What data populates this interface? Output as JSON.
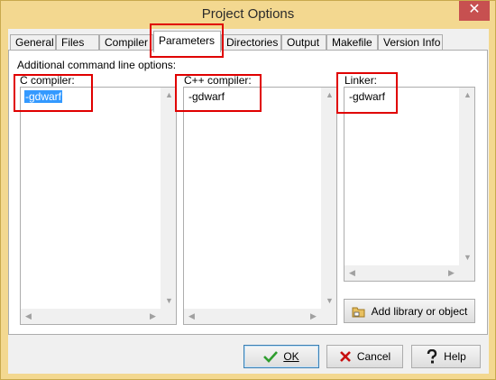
{
  "window": {
    "title": "Project Options",
    "close_glyph": "✕"
  },
  "tabs": [
    {
      "label": "General"
    },
    {
      "label": "Files"
    },
    {
      "label": "Compiler"
    },
    {
      "label": "Parameters"
    },
    {
      "label": "Directories"
    },
    {
      "label": "Output"
    },
    {
      "label": "Makefile"
    },
    {
      "label": "Version Info"
    }
  ],
  "active_tab": "Parameters",
  "page": {
    "heading": "Additional command line options:",
    "c_compiler": {
      "label": "C compiler:",
      "value": "-gdwarf"
    },
    "cpp_compiler": {
      "label": "C++ compiler:",
      "value": "-gdwarf"
    },
    "linker": {
      "label": "Linker:",
      "value": "-gdwarf"
    },
    "add_library_button": {
      "label": "Add library or object",
      "icon": "folder-add-icon"
    }
  },
  "buttons": {
    "ok": {
      "label": "OK",
      "icon": "checkmark-icon",
      "icon_color": "#2e9d2e"
    },
    "cancel": {
      "label": "Cancel",
      "icon": "x-icon",
      "icon_color": "#c81010"
    },
    "help": {
      "label": "Help",
      "icon": "question-icon"
    }
  },
  "highlight_color": "#e00000"
}
